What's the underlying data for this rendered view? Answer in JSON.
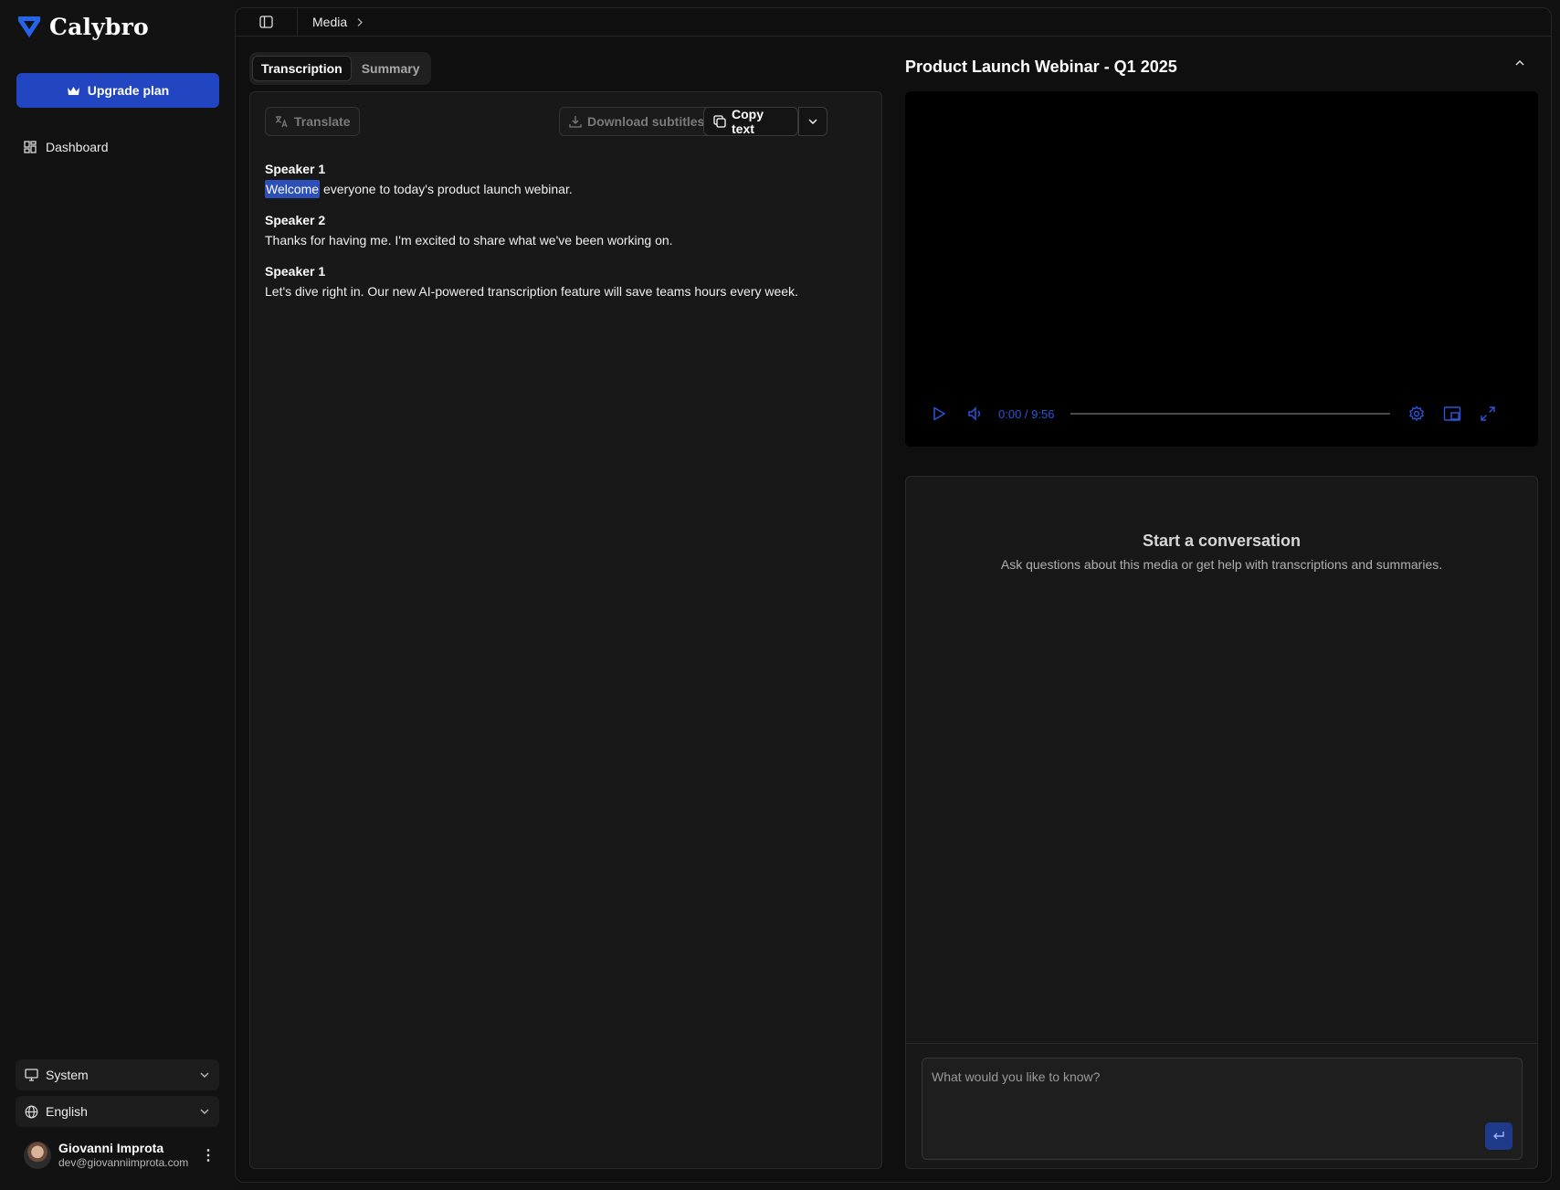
{
  "brand": {
    "name": "Calybro",
    "color": "#2563eb"
  },
  "sidebar": {
    "upgrade_label": "Upgrade plan",
    "items": [
      {
        "label": "Dashboard",
        "icon": "grid-icon"
      }
    ],
    "theme_select": {
      "value": "System",
      "icon": "monitor-icon"
    },
    "language_select": {
      "value": "English",
      "icon": "globe-icon"
    },
    "user": {
      "name": "Giovanni Improta",
      "email": "dev@giovanniimprota.com"
    }
  },
  "breadcrumb": {
    "current": "Media"
  },
  "tabs": [
    {
      "label": "Transcription",
      "active": true
    },
    {
      "label": "Summary",
      "active": false
    }
  ],
  "toolbar": {
    "translate_label": "Translate",
    "download_label": "Download subtitles",
    "copy_label": "Copy text"
  },
  "transcript": [
    {
      "speaker": "Speaker 1",
      "highlight": "Welcome",
      "text": " everyone to today's product launch webinar."
    },
    {
      "speaker": "Speaker 2",
      "highlight": "",
      "text": "Thanks for having me. I'm excited to share what we've been working on."
    },
    {
      "speaker": "Speaker 1",
      "highlight": "",
      "text": "Let's dive right in. Our new AI-powered transcription feature will save teams hours every week."
    }
  ],
  "video": {
    "title": "Product Launch Webinar - Q1 2025",
    "time": "0:00 / 9:56",
    "progress": 0
  },
  "chat": {
    "title": "Start a conversation",
    "subtitle": "Ask questions about this media or get help with transcriptions and summaries.",
    "placeholder": "What would you like to know?"
  },
  "colors": {
    "accent": "#2245c2",
    "highlight": "#2d4fb8",
    "player_controls": "#2b55d9"
  }
}
